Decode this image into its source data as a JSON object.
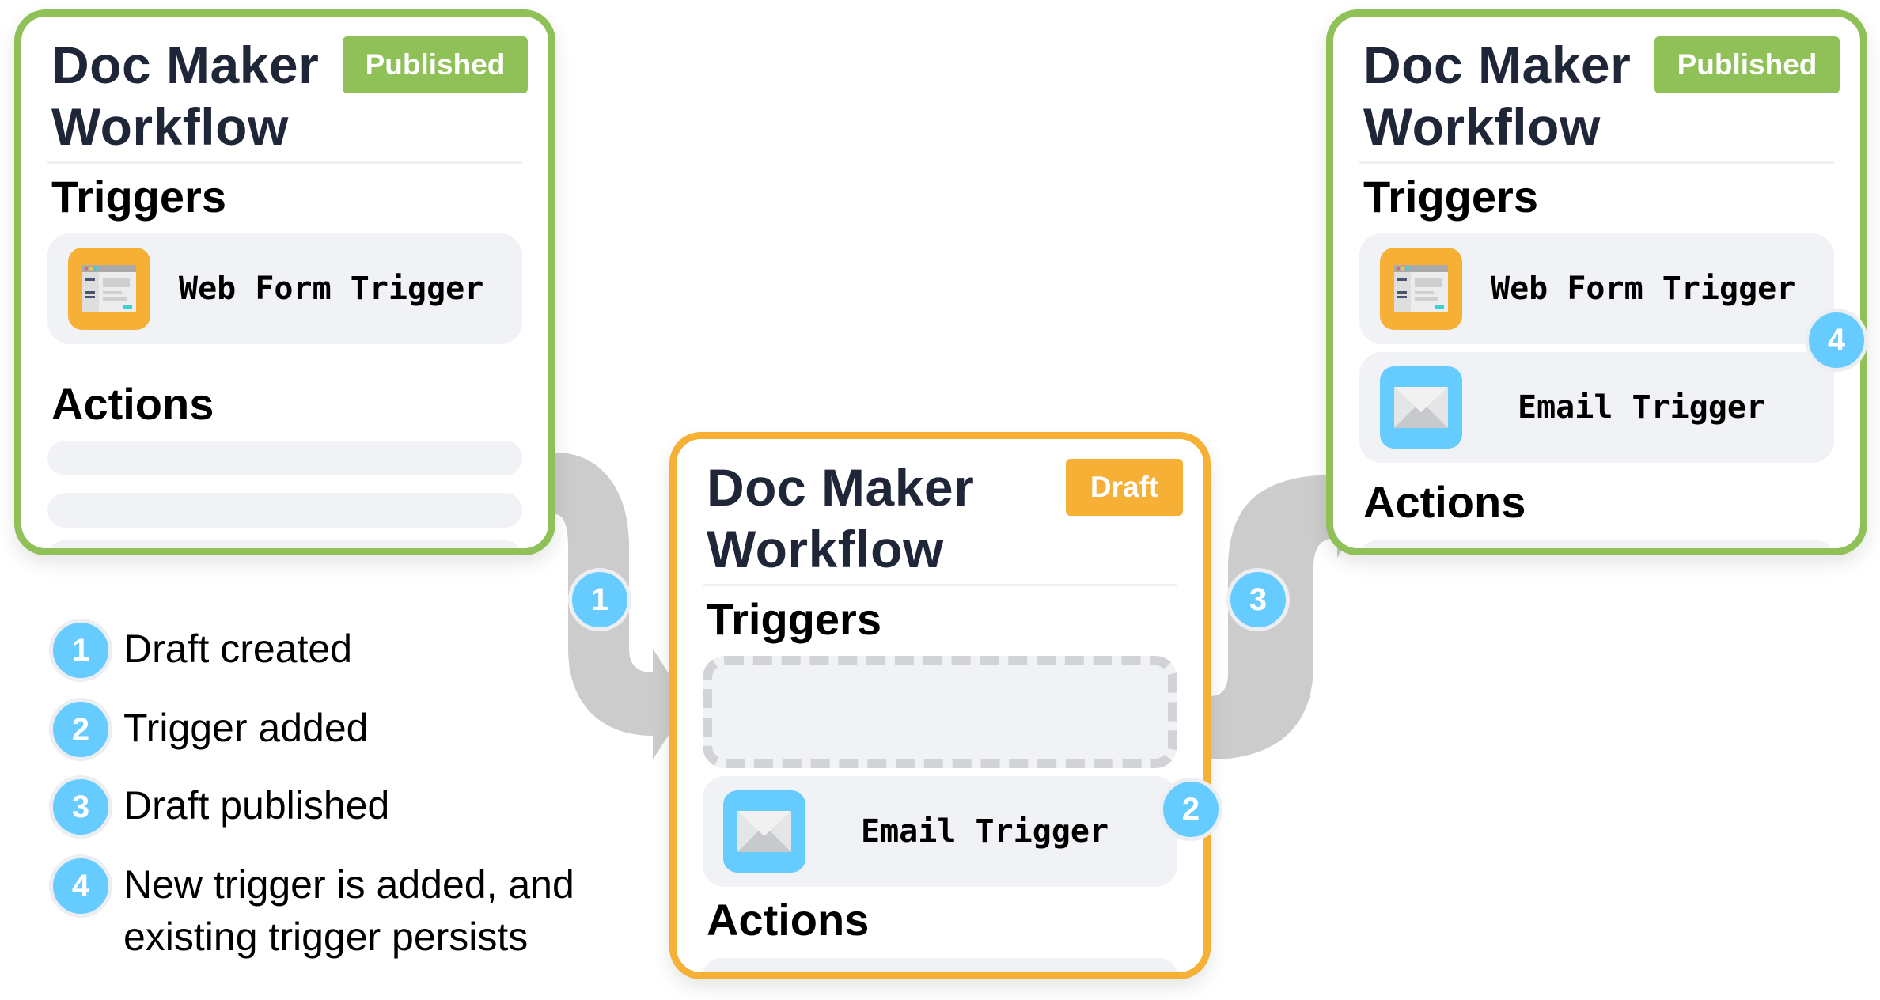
{
  "colors": {
    "published": "#8fc158",
    "draft": "#f5b035",
    "step_badge": "#66cbff",
    "arrow": "#cccccc",
    "row_bg": "#f1f2f6",
    "title_text": "#1f2638",
    "webform_icon_bg": "#f5b035",
    "email_icon_bg": "#66cbff"
  },
  "cards": {
    "left": {
      "title": "Doc Maker Workflow",
      "status": "Published",
      "triggers_heading": "Triggers",
      "triggers": [
        {
          "icon": "web-form-icon",
          "label": "Web Form Trigger"
        }
      ],
      "actions_heading": "Actions"
    },
    "middle": {
      "title": "Doc Maker Workflow",
      "status": "Draft",
      "triggers_heading": "Triggers",
      "triggers": [
        {
          "icon": "email-icon",
          "label": "Email Trigger"
        }
      ],
      "actions_heading": "Actions"
    },
    "right": {
      "title": "Doc Maker Workflow",
      "status": "Published",
      "triggers_heading": "Triggers",
      "triggers": [
        {
          "icon": "web-form-icon",
          "label": "Web Form Trigger"
        },
        {
          "icon": "email-icon",
          "label": "Email Trigger"
        }
      ],
      "actions_heading": "Actions"
    }
  },
  "steps": [
    "1",
    "2",
    "3",
    "4"
  ],
  "legend": [
    {
      "number": "1",
      "text": "Draft created"
    },
    {
      "number": "2",
      "text": "Trigger added"
    },
    {
      "number": "3",
      "text": "Draft published"
    },
    {
      "number": "4",
      "text": "New trigger is added, and",
      "text2": "existing trigger persists"
    }
  ]
}
